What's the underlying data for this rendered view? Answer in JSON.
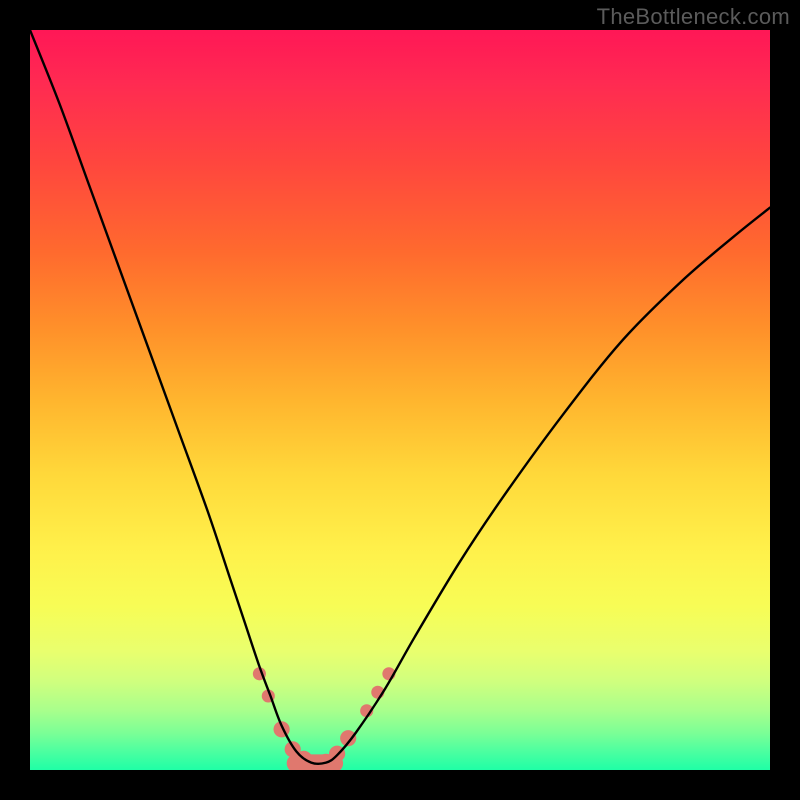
{
  "watermark": {
    "text": "TheBottleneck.com"
  },
  "chart_data": {
    "type": "line",
    "title": "",
    "xlabel": "",
    "ylabel": "",
    "xlim": [
      0,
      100
    ],
    "ylim": [
      0,
      100
    ],
    "grid": false,
    "series": [
      {
        "name": "bottleneck-curve",
        "x": [
          0,
          4,
          8,
          12,
          16,
          20,
          24,
          27,
          29,
          31,
          32.5,
          34,
          36,
          38,
          40,
          41.5,
          44,
          48,
          52,
          58,
          64,
          72,
          80,
          88,
          95,
          100
        ],
        "y": [
          100,
          90,
          79,
          68,
          57,
          46,
          35,
          26,
          20,
          14,
          10,
          6,
          2.5,
          1,
          1,
          2,
          5,
          11,
          18,
          28,
          37,
          48,
          58,
          66,
          72,
          76
        ]
      }
    ],
    "markers": {
      "name": "highlight-beads",
      "color": "#e0786e",
      "points": [
        {
          "x": 31.0,
          "y": 13.0,
          "r": 1.7
        },
        {
          "x": 32.2,
          "y": 10.0,
          "r": 1.7
        },
        {
          "x": 34.0,
          "y": 5.5,
          "r": 2.1
        },
        {
          "x": 35.5,
          "y": 2.8,
          "r": 2.1
        },
        {
          "x": 37.0,
          "y": 1.4,
          "r": 2.3
        },
        {
          "x": 38.5,
          "y": 0.9,
          "r": 2.3
        },
        {
          "x": 40.0,
          "y": 1.0,
          "r": 2.3
        },
        {
          "x": 41.5,
          "y": 2.2,
          "r": 2.1
        },
        {
          "x": 43.0,
          "y": 4.3,
          "r": 2.1
        },
        {
          "x": 45.5,
          "y": 8.0,
          "r": 1.7
        },
        {
          "x": 47.0,
          "y": 10.5,
          "r": 1.7
        },
        {
          "x": 48.5,
          "y": 13.0,
          "r": 1.7
        }
      ]
    },
    "gradient_stops": [
      {
        "pos": 0.0,
        "color": "#ff1756"
      },
      {
        "pos": 0.5,
        "color": "#ffd83a"
      },
      {
        "pos": 0.85,
        "color": "#f0ff5a"
      },
      {
        "pos": 1.0,
        "color": "#1fffa6"
      }
    ]
  }
}
